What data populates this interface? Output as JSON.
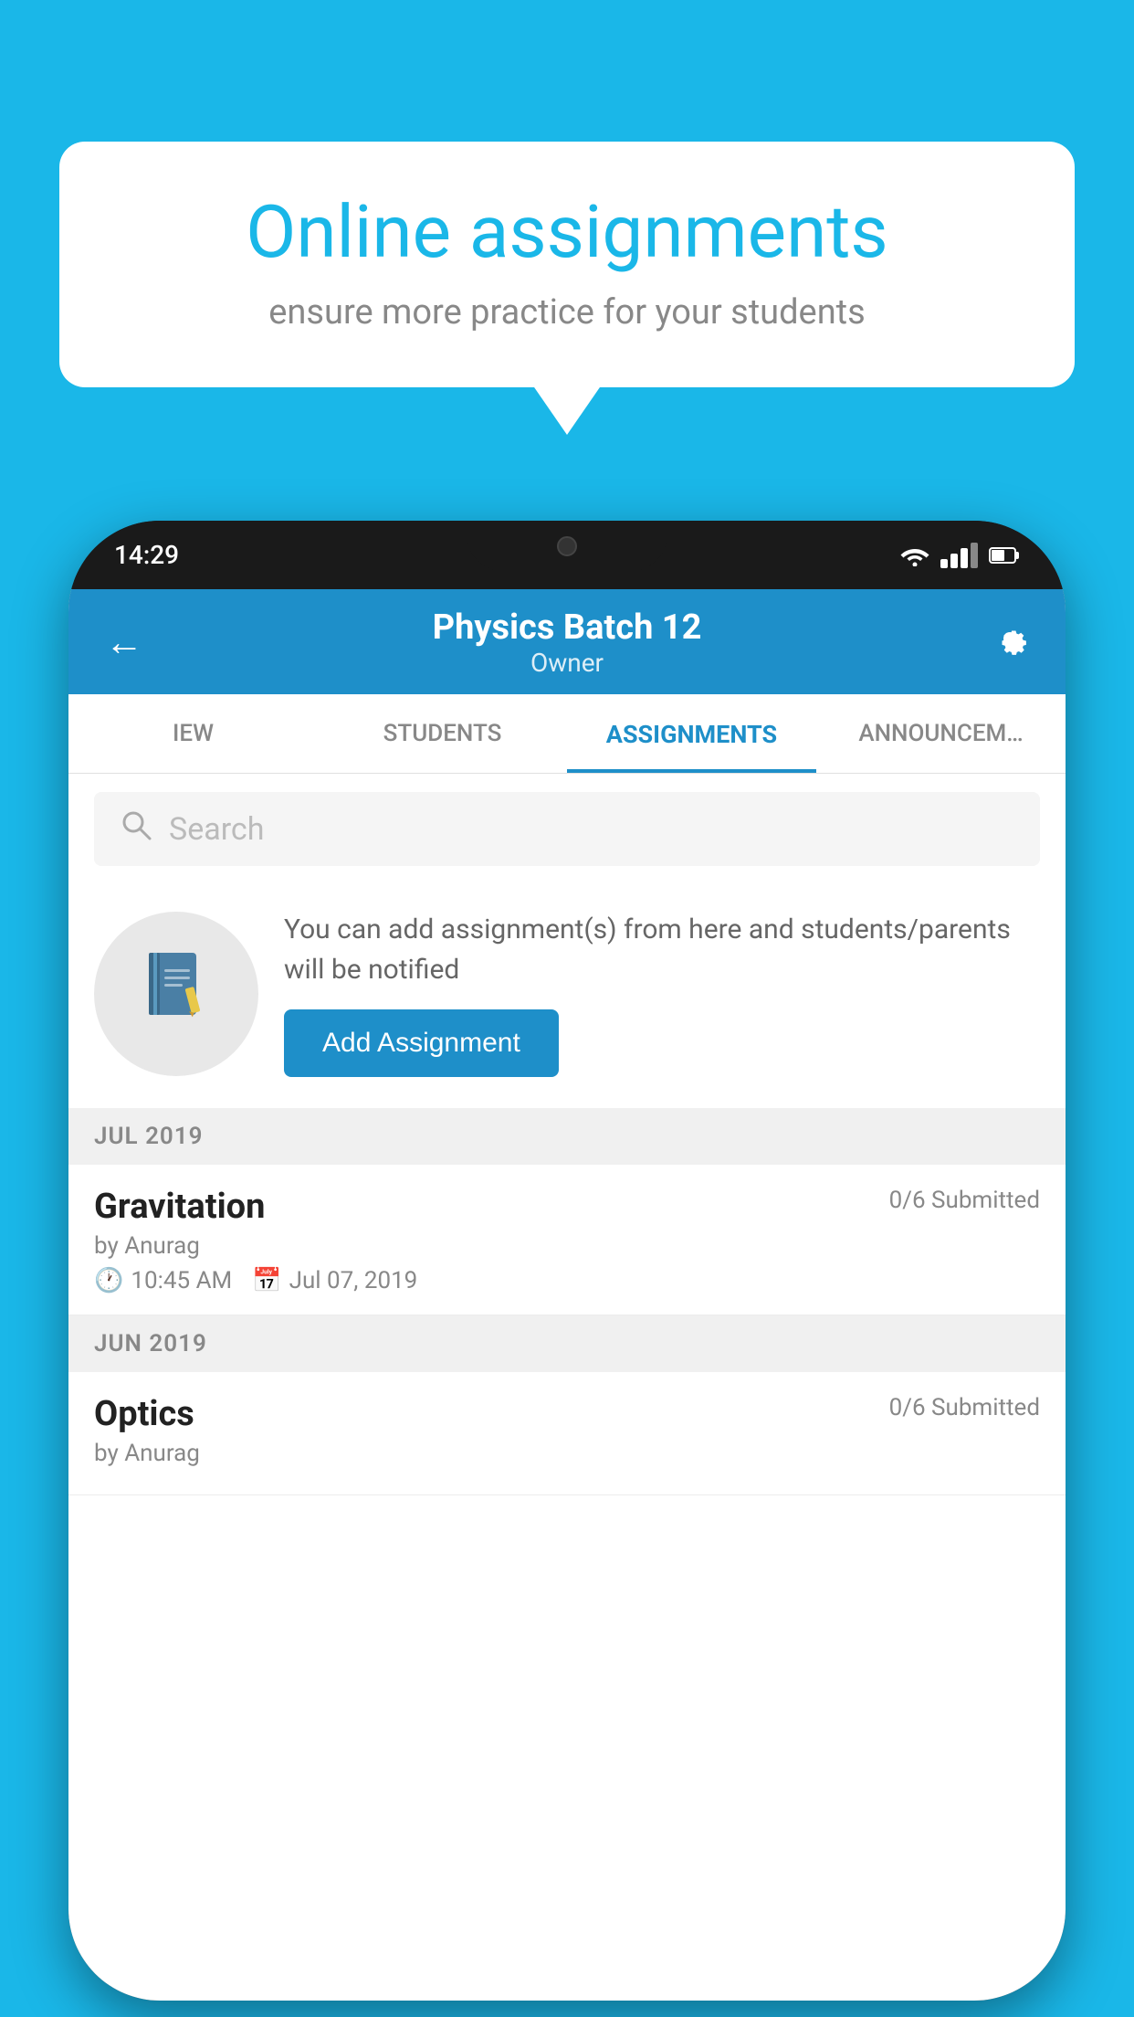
{
  "background_color": "#1ab7e8",
  "speech_bubble": {
    "title": "Online assignments",
    "subtitle": "ensure more practice for your students"
  },
  "phone": {
    "status_bar": {
      "time": "14:29"
    },
    "header": {
      "title": "Physics Batch 12",
      "subtitle": "Owner",
      "back_label": "←",
      "settings_label": "⚙"
    },
    "tabs": [
      {
        "label": "IEW",
        "active": false
      },
      {
        "label": "STUDENTS",
        "active": false
      },
      {
        "label": "ASSIGNMENTS",
        "active": true
      },
      {
        "label": "ANNOUNCEM…",
        "active": false
      }
    ],
    "search": {
      "placeholder": "Search"
    },
    "info_card": {
      "description": "You can add assignment(s) from here and students/parents will be notified",
      "add_button_label": "Add Assignment"
    },
    "sections": [
      {
        "month_label": "JUL 2019",
        "assignments": [
          {
            "name": "Gravitation",
            "submitted": "0/6 Submitted",
            "by": "by Anurag",
            "time": "10:45 AM",
            "date": "Jul 07, 2019"
          }
        ]
      },
      {
        "month_label": "JUN 2019",
        "assignments": [
          {
            "name": "Optics",
            "submitted": "0/6 Submitted",
            "by": "by Anurag",
            "time": "",
            "date": ""
          }
        ]
      }
    ]
  }
}
